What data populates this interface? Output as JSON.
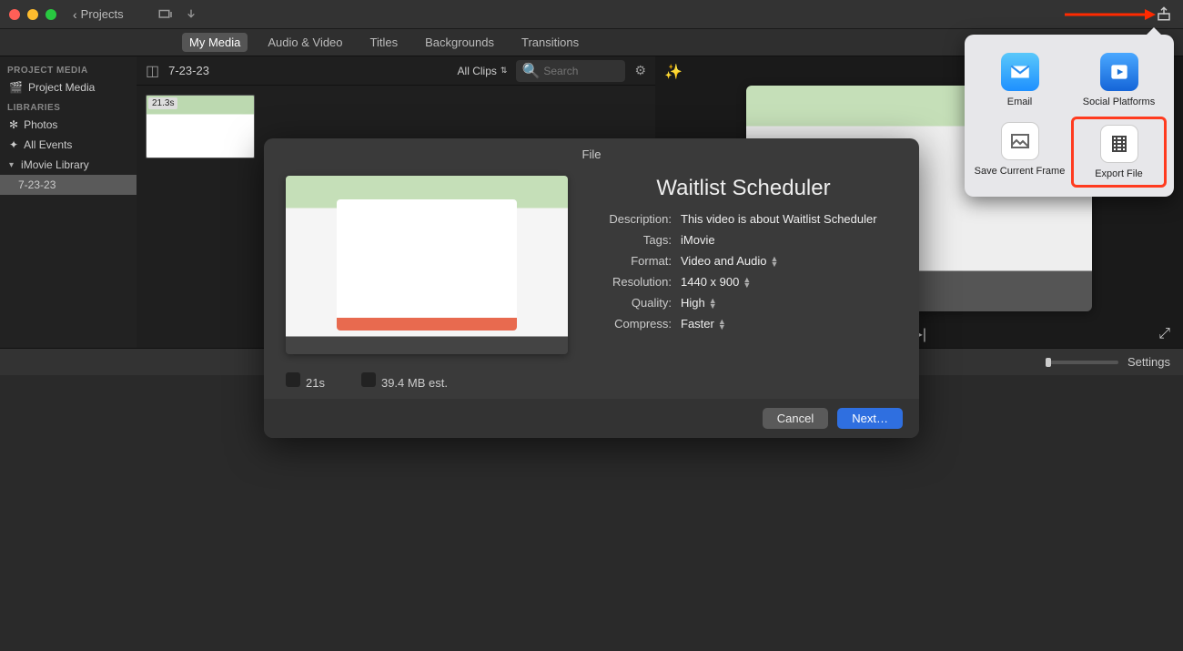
{
  "topbar": {
    "projects_label": "Projects"
  },
  "tabs": {
    "my_media": "My Media",
    "audio_video": "Audio & Video",
    "titles": "Titles",
    "backgrounds": "Backgrounds",
    "transitions": "Transitions"
  },
  "sidebar": {
    "hdr_project_media": "PROJECT MEDIA",
    "item_project_media": "Project Media",
    "hdr_libraries": "LIBRARIES",
    "item_photos": "Photos",
    "item_all_events": "All Events",
    "item_imovie_library": "iMovie Library",
    "item_date_event": "7-23-23"
  },
  "browser": {
    "project_label": "7-23-23",
    "all_clips": "All Clips",
    "search_placeholder": "Search",
    "clip_duration_badge": "21.3s"
  },
  "timeline": {
    "settings_label": "Settings"
  },
  "popover": {
    "email": "Email",
    "social": "Social Platforms",
    "save_frame": "Save Current Frame",
    "export_file": "Export File"
  },
  "dialog": {
    "title": "File",
    "name": "Waitlist Scheduler",
    "rows": {
      "description_label": "Description:",
      "description_value": "This video is about Waitlist Scheduler",
      "tags_label": "Tags:",
      "tags_value": "iMovie",
      "format_label": "Format:",
      "format_value": "Video and Audio",
      "resolution_label": "Resolution:",
      "resolution_value": "1440 x 900",
      "quality_label": "Quality:",
      "quality_value": "High",
      "compress_label": "Compress:",
      "compress_value": "Faster"
    },
    "meta": {
      "duration": "21s",
      "filesize": "39.4 MB est."
    },
    "buttons": {
      "cancel": "Cancel",
      "next": "Next…"
    }
  }
}
